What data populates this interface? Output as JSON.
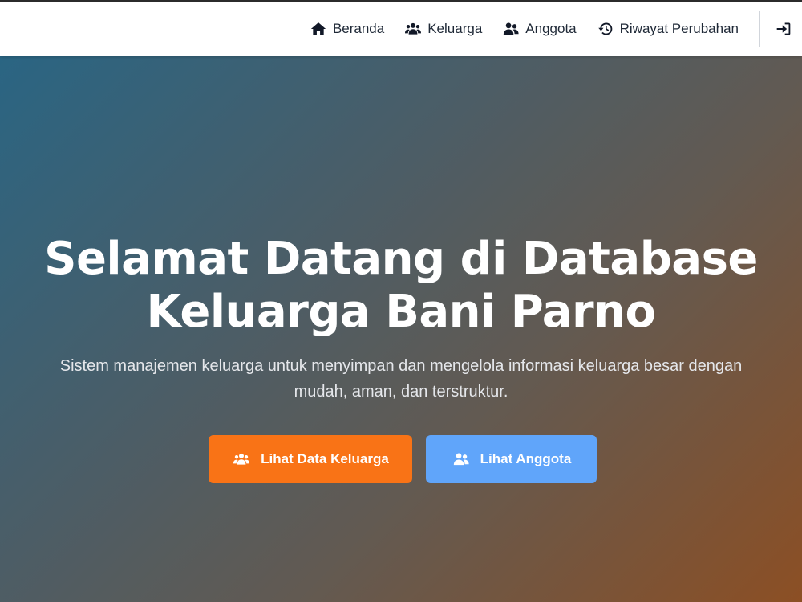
{
  "navbar": {
    "items": [
      {
        "label": "Beranda",
        "icon": "home-icon"
      },
      {
        "label": "Keluarga",
        "icon": "users-icon"
      },
      {
        "label": "Anggota",
        "icon": "user-friends-icon"
      },
      {
        "label": "Riwayat Perubahan",
        "icon": "history-icon"
      }
    ],
    "login_icon": "sign-in-icon"
  },
  "hero": {
    "title_line1": "Selamat Datang di Database",
    "title_line2": "Keluarga Bani Parno",
    "subtitle_line1": "Sistem manajemen keluarga untuk menyimpan dan mengelola informasi keluarga besar dengan",
    "subtitle_line2": "mudah, aman, dan terstruktur.",
    "primary_button": {
      "label": "Lihat Data Keluarga",
      "icon": "users-icon",
      "color": "#f97316"
    },
    "secondary_button": {
      "label": "Lihat Anggota",
      "icon": "user-friends-icon",
      "color": "#60a5fa"
    }
  },
  "colors": {
    "gradient_start": "#2a6583",
    "gradient_end": "#8c4f24",
    "nav_text": "#1f2937"
  }
}
